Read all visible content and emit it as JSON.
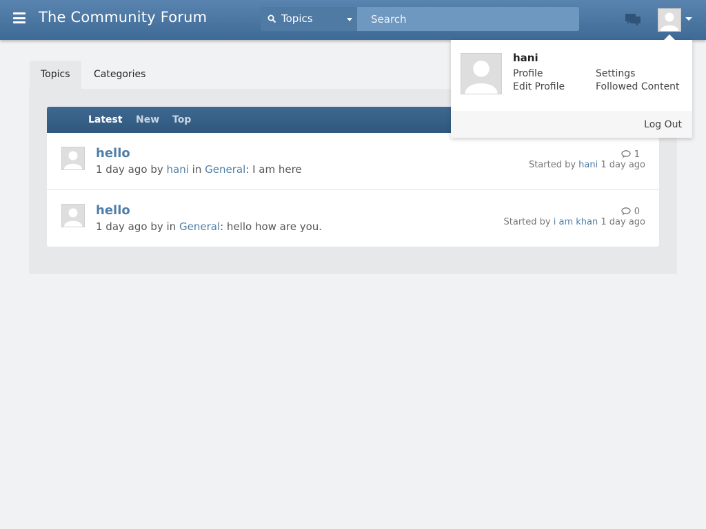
{
  "header": {
    "site_title": "The Community Forum",
    "search_scope": "Topics",
    "search_placeholder": "Search",
    "menu_icon": "hamburger-menu-icon",
    "chat_icon": "chat-bubbles-icon",
    "avatar_icon": "default-avatar-icon"
  },
  "tabs": [
    {
      "label": "Topics",
      "active": true
    },
    {
      "label": "Categories",
      "active": false
    }
  ],
  "sort": {
    "latest": "Latest",
    "new": "New",
    "top": "Top"
  },
  "topics": [
    {
      "title": "hello",
      "age": "1 day ago by",
      "author": "hani",
      "in_word": "in",
      "category": "General",
      "excerpt": ": I am here",
      "reply_count": "1",
      "started_label": "Started by",
      "started_by": "hani",
      "started_when": "1 day ago"
    },
    {
      "title": "hello",
      "age": "1 day ago by",
      "in_word": "in",
      "category": "General",
      "excerpt": ": hello how are you.",
      "reply_count": "0",
      "started_label": "Started by",
      "started_by": "i am khan",
      "started_when": "1 day ago"
    }
  ],
  "user_menu": {
    "name": "hani",
    "profile": "Profile",
    "edit_profile": "Edit Profile",
    "settings": "Settings",
    "followed_content": "Followed Content",
    "log_out": "Log Out"
  },
  "colors": {
    "header": "#4a76a1",
    "link": "#4f7ea8",
    "background": "#f1f2f3"
  }
}
